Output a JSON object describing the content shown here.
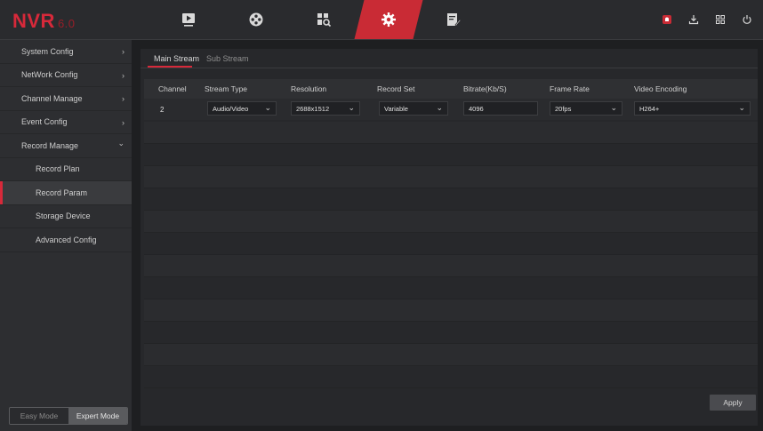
{
  "app": {
    "logo_name": "NVR",
    "logo_version": "6.0"
  },
  "topnav": [
    {
      "name": "live-view",
      "icon": "play-screen-icon"
    },
    {
      "name": "playback",
      "icon": "reel-icon"
    },
    {
      "name": "search",
      "icon": "file-search-icon"
    },
    {
      "name": "settings",
      "icon": "gear-icon",
      "active": true
    },
    {
      "name": "operation",
      "icon": "edit-doc-icon"
    }
  ],
  "right_icons": [
    "alarm-icon",
    "download-icon",
    "grid-icon",
    "power-icon"
  ],
  "sidebar": {
    "items": [
      {
        "label": "System Config",
        "chevron": "›"
      },
      {
        "label": "NetWork Config",
        "chevron": "›"
      },
      {
        "label": "Channel Manage",
        "chevron": "›"
      },
      {
        "label": "Event Config",
        "chevron": "›"
      },
      {
        "label": "Record Manage",
        "chevron": "⌄"
      }
    ],
    "sub_items": [
      {
        "label": "Record Plan"
      },
      {
        "label": "Record Param",
        "active": true
      },
      {
        "label": "Storage Device"
      },
      {
        "label": "Advanced Config"
      }
    ],
    "modes": {
      "easy": "Easy Mode",
      "expert": "Expert Mode"
    }
  },
  "tabs": {
    "main": "Main Stream",
    "sub": "Sub Stream"
  },
  "table": {
    "headers": [
      "Channel",
      "Stream Type",
      "Resolution",
      "Record Set",
      "Bitrate(Kb/S)",
      "Frame Rate",
      "Video Encoding"
    ],
    "row": {
      "channel": "2",
      "stream_type": "Audio/Video",
      "resolution": "2688x1512",
      "record_set": "Variable",
      "bitrate": "4096",
      "frame_rate": "20fps",
      "video_encoding": "H264+"
    }
  },
  "buttons": {
    "apply": "Apply"
  },
  "colors": {
    "accent": "#d7293a",
    "background": "#1e1f21",
    "panel": "#27282b"
  }
}
